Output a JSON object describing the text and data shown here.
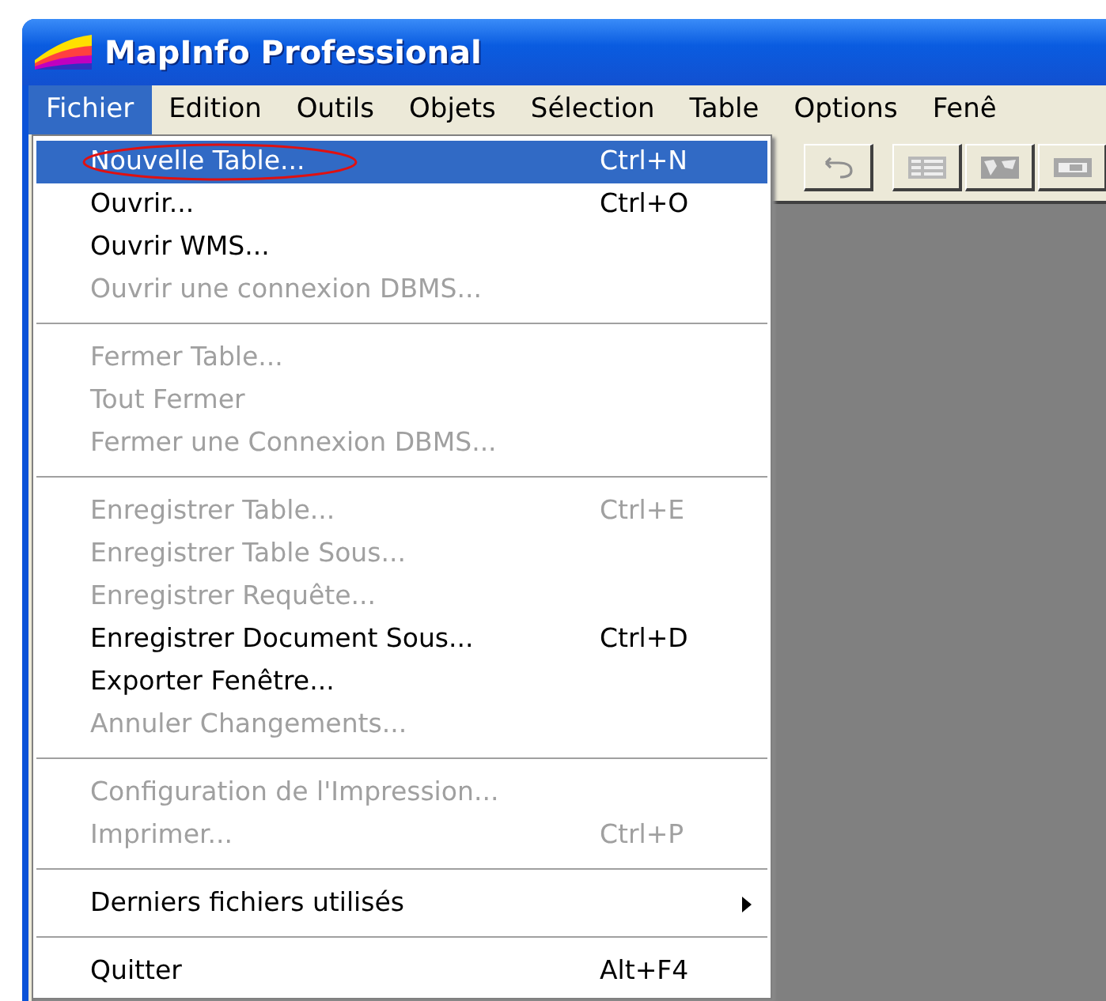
{
  "window": {
    "title": "MapInfo Professional"
  },
  "menubar": [
    {
      "label": "Fichier",
      "selected": true
    },
    {
      "label": "Edition",
      "selected": false
    },
    {
      "label": "Outils",
      "selected": false
    },
    {
      "label": "Objets",
      "selected": false
    },
    {
      "label": "Sélection",
      "selected": false
    },
    {
      "label": "Table",
      "selected": false
    },
    {
      "label": "Options",
      "selected": false
    },
    {
      "label": "Fenê",
      "selected": false
    }
  ],
  "menu": [
    {
      "kind": "item",
      "label": "Nouvelle Table...",
      "shortcut": "Ctrl+N",
      "disabled": false,
      "selected": true,
      "circled": true
    },
    {
      "kind": "item",
      "label": "Ouvrir...",
      "shortcut": "Ctrl+O",
      "disabled": false,
      "selected": false
    },
    {
      "kind": "item",
      "label": "Ouvrir WMS...",
      "disabled": false,
      "selected": false
    },
    {
      "kind": "item",
      "label": "Ouvrir une connexion DBMS...",
      "disabled": true,
      "selected": false
    },
    {
      "kind": "separator"
    },
    {
      "kind": "item",
      "label": "Fermer Table...",
      "disabled": true,
      "selected": false
    },
    {
      "kind": "item",
      "label": "Tout Fermer",
      "disabled": true,
      "selected": false
    },
    {
      "kind": "item",
      "label": "Fermer une Connexion  DBMS...",
      "disabled": true,
      "selected": false
    },
    {
      "kind": "separator"
    },
    {
      "kind": "item",
      "label": "Enregistrer Table...",
      "shortcut": "Ctrl+E",
      "disabled": true,
      "selected": false
    },
    {
      "kind": "item",
      "label": "Enregistrer Table Sous...",
      "disabled": true,
      "selected": false
    },
    {
      "kind": "item",
      "label": "Enregistrer Requête...",
      "disabled": true,
      "selected": false
    },
    {
      "kind": "item",
      "label": "Enregistrer Document Sous...",
      "shortcut": "Ctrl+D",
      "disabled": false,
      "selected": false
    },
    {
      "kind": "item",
      "label": "Exporter Fenêtre...",
      "disabled": false,
      "selected": false
    },
    {
      "kind": "item",
      "label": "Annuler Changements...",
      "disabled": true,
      "selected": false
    },
    {
      "kind": "separator"
    },
    {
      "kind": "item",
      "label": "Configuration de l'Impression...",
      "disabled": true,
      "selected": false
    },
    {
      "kind": "item",
      "label": "Imprimer...",
      "shortcut": "Ctrl+P",
      "disabled": true,
      "selected": false
    },
    {
      "kind": "separator"
    },
    {
      "kind": "item",
      "label": "Derniers fichiers utilisés",
      "disabled": false,
      "selected": false,
      "submenu": true
    },
    {
      "kind": "separator"
    },
    {
      "kind": "item",
      "label": "Quitter",
      "shortcut": "Alt+F4",
      "disabled": false,
      "selected": false
    }
  ]
}
